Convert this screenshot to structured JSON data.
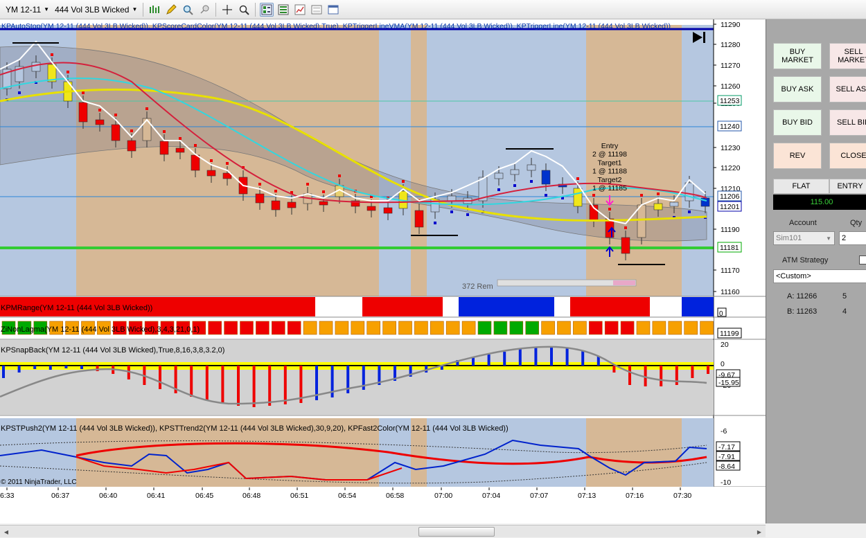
{
  "toolbar": {
    "instrument": "YM 12-11",
    "period": "444 Vol 3LB Wicked",
    "buttons": [
      "bar-type-icon",
      "pencil-icon",
      "zoom-icon",
      "crosshair-icon",
      "magnifier-icon",
      "data-box-icon",
      "properties-icon",
      "chart-style-icon",
      "image-icon",
      "window-icon"
    ]
  },
  "chart": {
    "header_text": "KPAutoStop(YM 12-11 (444 Vol 3LB Wicked)), KPScoreCardColor(YM 12-11 (444 Vol 3LB Wicked),True), KPTriggerLineVMA(YM 12-11 (444 Vol 3LB Wicked)), KPTriggerLine(YM 12-11 (444 Vol 3LB Wicked))",
    "price_axis_labels": [
      "11290",
      "11280",
      "11270",
      "11260",
      "11250",
      "11230",
      "11220",
      "11210",
      "11190",
      "11170",
      "11160"
    ],
    "price_flags": [
      {
        "label": "11253",
        "color": "#009966"
      },
      {
        "label": "11240",
        "color": "#2255aa"
      },
      {
        "label": "11206",
        "color": "#2255aa"
      },
      {
        "label": "11201",
        "color": "#0000aa"
      },
      {
        "label": "11181",
        "color": "#00aa00"
      }
    ],
    "entry_annotation": [
      "Entry",
      "2 @ 11198",
      "Target1",
      "1 @ 11188",
      "Target2",
      "1 @ 11185"
    ],
    "remaining_text": "372 Rem",
    "panels": {
      "range": {
        "label": "KPMRange(YM 12-11 (444 Vol 3LB Wicked))",
        "flag": "0"
      },
      "nonlag": {
        "label": "ZiNonLagma(YM 12-11 (444 Vol 3LB Wicked),3,4,3,21,0,1)",
        "flag": "11199"
      },
      "snapback": {
        "label": "KPSnapBack(YM 12-11 (444 Vol 3LB Wicked),True,8,16,3,8,3.2,0)",
        "axis": [
          "20",
          "0",
          "-20"
        ],
        "flags": [
          "-9.67",
          "-15.95"
        ]
      },
      "push": {
        "label": "KPSTPush2(YM 12-11 (444 Vol 3LB Wicked)), KPSTTrend2(YM 12-11 (444 Vol 3LB Wicked),30,9,20), KPFast2Color(YM 12-11 (444 Vol 3LB Wicked))",
        "axis": [
          "-6",
          "-10"
        ],
        "flags": [
          "-7.17",
          "-7.91",
          "-8.64"
        ]
      }
    },
    "copyright": "© 2011 NinjaTrader, LLC",
    "time_labels": [
      "6:33",
      "06:37",
      "06:40",
      "06:41",
      "06:45",
      "06:48",
      "06:51",
      "06:54",
      "06:58",
      "07:00",
      "07:04",
      "07:07",
      "07:13",
      "07:16",
      "07:30"
    ]
  },
  "panel": {
    "buttons": {
      "buy_market": "BUY\nMARKET",
      "sell_market": "SELL\nMARKET",
      "buy_ask": "BUY ASK",
      "sell_ask": "SELL ASK",
      "buy_bid": "BUY BID",
      "sell_bid": "SELL BID",
      "rev": "REV",
      "close": "CLOSE"
    },
    "position": {
      "status": "FLAT",
      "entry_label": "ENTRY",
      "pnl": "115.00"
    },
    "account_label": "Account",
    "account_value": "Sim101",
    "qty_label": "Qty",
    "qty_value": "2",
    "atm_label": "ATM Strategy",
    "atm_value": "<Custom>",
    "ask": {
      "label": "A: 11266",
      "size": "5"
    },
    "bid": {
      "label": "B: 11263",
      "size": "4"
    }
  }
}
